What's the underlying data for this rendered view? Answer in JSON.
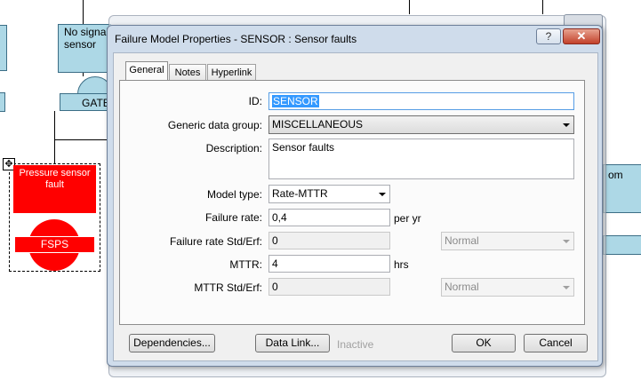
{
  "background": {
    "gate_box_text": "No signal\nsensor",
    "gate_label": "GATE",
    "right_box_text": "om",
    "event": {
      "title": "Pressure sensor\nfault",
      "label": "FSPS"
    },
    "move_handle_glyph": "✥"
  },
  "dialog": {
    "title": "Failure Model Properties - SENSOR : Sensor faults",
    "help_glyph": "?",
    "close_glyph": "✕",
    "tabs": [
      {
        "label": "General",
        "active": true
      },
      {
        "label": "Notes",
        "active": false
      },
      {
        "label": "Hyperlink",
        "active": false
      }
    ],
    "form": {
      "id_label": "ID:",
      "id_value": "SENSOR",
      "generic_group_label": "Generic data group:",
      "generic_group_value": "MISCELLANEOUS",
      "description_label": "Description:",
      "description_value": "Sensor faults",
      "model_type_label": "Model type:",
      "model_type_value": "Rate-MTTR",
      "failure_rate_label": "Failure rate:",
      "failure_rate_value": "0,4",
      "failure_rate_unit": "per yr",
      "failure_rate_std_label": "Failure rate Std/Erf:",
      "failure_rate_std_value": "0",
      "failure_rate_dist": "Normal",
      "mttr_label": "MTTR:",
      "mttr_value": "4",
      "mttr_unit": "hrs",
      "mttr_std_label": "MTTR Std/Erf:",
      "mttr_std_value": "0",
      "mttr_dist": "Normal"
    },
    "buttons": {
      "dependencies": "Dependencies...",
      "data_link": "Data Link...",
      "inactive_text": "Inactive",
      "ok": "OK",
      "cancel": "Cancel"
    }
  }
}
